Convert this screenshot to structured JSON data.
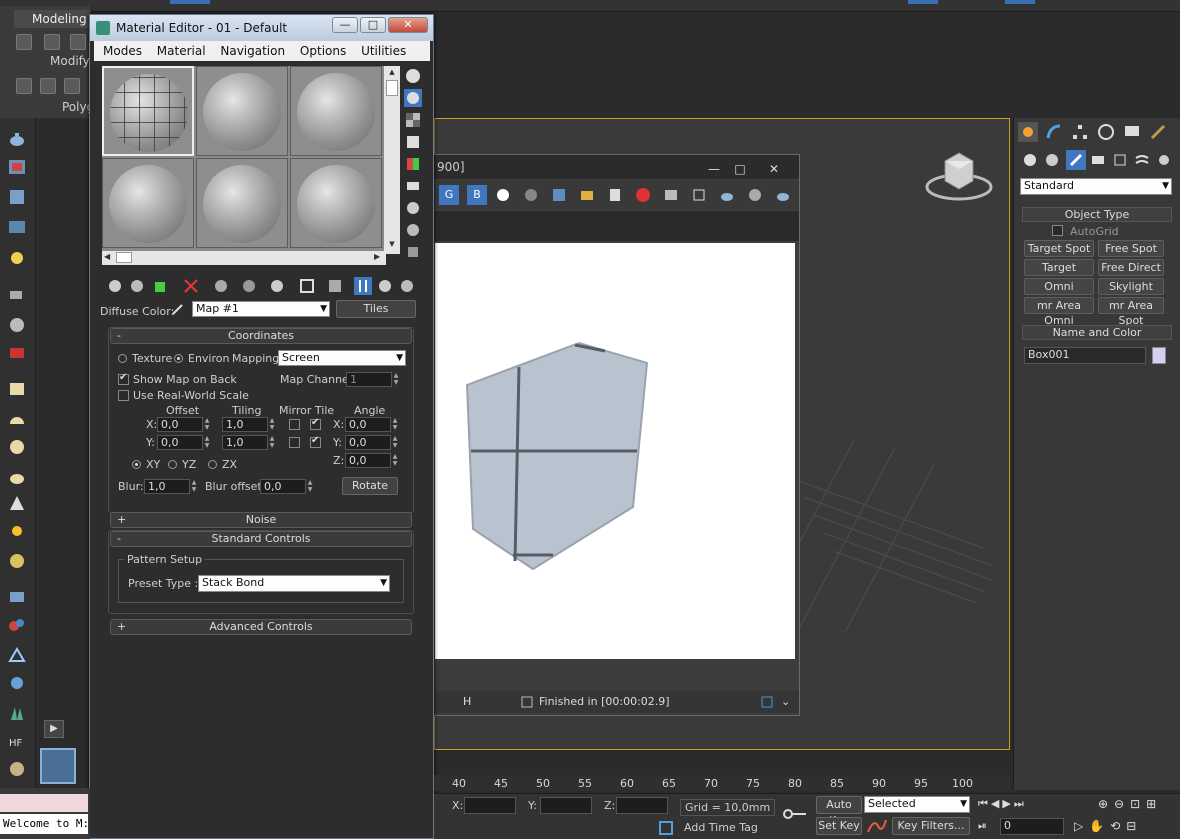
{
  "ribbon": {
    "tab_modeling": "Modeling",
    "modify": "Modify",
    "polygon": "Polyg"
  },
  "material_editor": {
    "title": "Material Editor - 01 - Default",
    "window_buttons": [
      "—",
      "□",
      "✕"
    ],
    "menu": [
      "Modes",
      "Material",
      "Navigation",
      "Options",
      "Utilities"
    ],
    "diffuse_label": "Diffuse Color:",
    "map_name": "Map #1",
    "map_type": "Tiles",
    "coordinates": {
      "header": "Coordinates",
      "texture": "Texture",
      "environ": "Environ",
      "mapping_label": "Mapping:",
      "mapping_value": "Screen",
      "show_map_on_back": "Show Map on Back",
      "map_channel_label": "Map Channel:",
      "map_channel_value": "1",
      "use_real_world": "Use Real-World Scale",
      "col_offset": "Offset",
      "col_tiling": "Tiling",
      "col_mirror_tile": "Mirror Tile",
      "col_angle": "Angle",
      "x_label": "X:",
      "y_label": "Y:",
      "z_label": "Z:",
      "offset_x": "0,0",
      "offset_y": "0,0",
      "tiling_x": "1,0",
      "tiling_y": "1,0",
      "angle_x": "0,0",
      "angle_y": "0,0",
      "angle_z": "0,0",
      "axis_xy": "XY",
      "axis_yz": "YZ",
      "axis_zx": "ZX",
      "blur_label": "Blur:",
      "blur_value": "1,0",
      "blur_offset_label": "Blur offset:",
      "blur_offset_value": "0,0",
      "rotate": "Rotate"
    },
    "noise_header": "Noise",
    "standard_controls_header": "Standard Controls",
    "pattern_setup": "Pattern Setup",
    "preset_type_label": "Preset Type :",
    "preset_type_value": "Stack Bond",
    "advanced_controls_header": "Advanced Controls"
  },
  "render_frame": {
    "title": "900]",
    "window_buttons": [
      "—",
      "□",
      "✕"
    ],
    "channel_g": "G",
    "channel_b": "B",
    "status": "Finished in [00:00:02.9]",
    "status_h": "H"
  },
  "command_panel": {
    "category": "Standard",
    "object_type_header": "Object Type",
    "autogrid": "AutoGrid",
    "buttons": [
      "Target Spot",
      "Free Spot",
      "Target Direct",
      "Free Direct",
      "Omni",
      "Skylight",
      "mr Area Omni",
      "mr Area Spot"
    ],
    "name_color_header": "Name and Color",
    "object_name": "Box001",
    "object_color": "#d8cff0"
  },
  "timeline": {
    "ticks": [
      "40",
      "45",
      "50",
      "55",
      "60",
      "65",
      "70",
      "75",
      "80",
      "85",
      "90",
      "95",
      "100"
    ]
  },
  "status_bar": {
    "x_label": "X:",
    "y_label": "Y:",
    "z_label": "Z:",
    "grid": "Grid = 10,0mm",
    "auto_key": "Auto Key",
    "selected": "Selected",
    "set_key": "Set Key",
    "key_filters": "Key Filters...",
    "add_time_tag": "Add Time Tag",
    "frame": "0",
    "listener": "Welcome to M:"
  },
  "colors": {
    "accent": "#3a6fb5",
    "viewport_border": "#c9a21e",
    "title_bar": "#d9e5f2"
  }
}
